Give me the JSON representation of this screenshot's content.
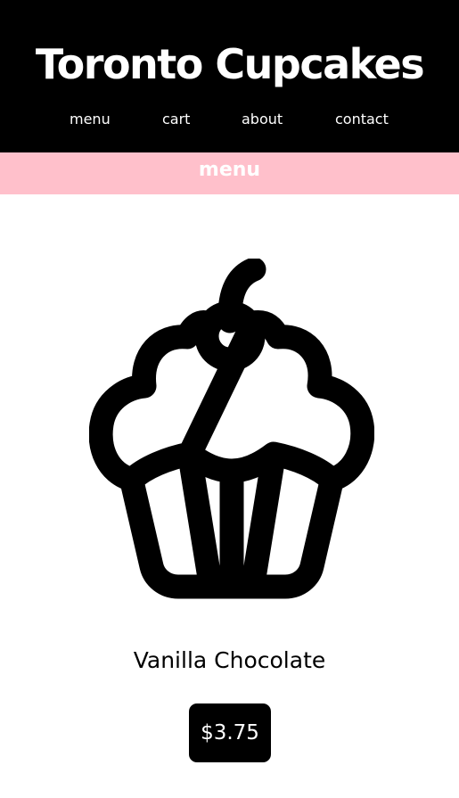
{
  "header": {
    "title": "Toronto Cupcakes",
    "nav": [
      {
        "label": "menu"
      },
      {
        "label": "cart"
      },
      {
        "label": "about"
      },
      {
        "label": "contact"
      }
    ]
  },
  "section": {
    "title": "menu"
  },
  "product": {
    "icon": "cupcake-icon",
    "name": "Vanilla Chocolate",
    "price": "$3.75"
  },
  "colors": {
    "header_bg": "#000000",
    "banner_bg": "#ffc0cb",
    "text_light": "#ffffff",
    "price_bg": "#000000"
  }
}
